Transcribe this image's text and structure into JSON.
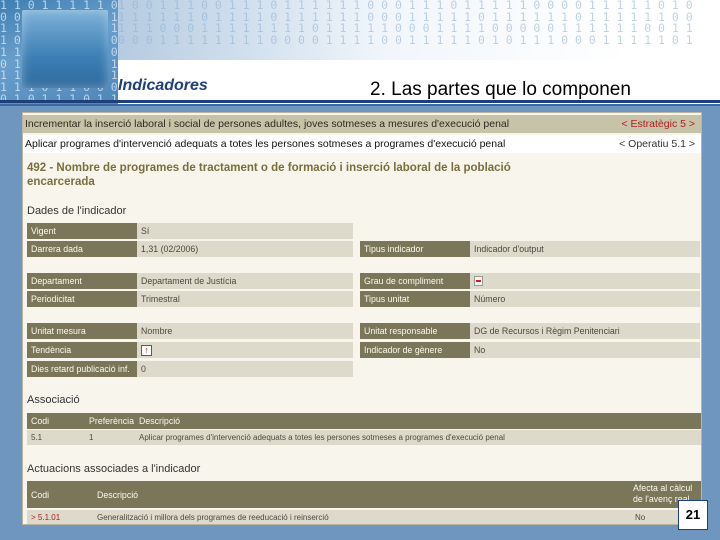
{
  "slide": {
    "section": "Indicadores",
    "title": "2. Las partes que lo componen",
    "page_number": "21"
  },
  "screenshot": {
    "breadcrumb_objective": {
      "text": "Incrementar la inserció laboral i social de persones adultes, joves sotmeses a mesures d'execució penal",
      "nav": "< Estratègic 5 >"
    },
    "breadcrumb_operational": {
      "text": "Aplicar programes d'intervenció adequats a totes les persones sotmeses a programes d'execució penal",
      "nav": "< Operatiu 5.1 >"
    },
    "indicator_title": "492 - Nombre de programes de tractament o de formació i inserció laboral de la població encarcerada",
    "dades_heading": "Dades de l'indicador",
    "fields": {
      "vigent": {
        "label": "Vigent",
        "value": "Sí"
      },
      "darrera_dada": {
        "label": "Darrera dada",
        "value": "1,31 (02/2006)"
      },
      "tipus_indicador": {
        "label": "Tipus indicador",
        "value": "Indicador d'output"
      },
      "departament": {
        "label": "Departament",
        "value": "Departament de Justícia"
      },
      "grau_compliment": {
        "label": "Grau de compliment",
        "icon": "book-icon"
      },
      "periodicitat": {
        "label": "Periodicitat",
        "value": "Trimestral"
      },
      "tipus_unitat": {
        "label": "Tipus unitat",
        "value": "Número"
      },
      "unitat_mesura": {
        "label": "Unitat mesura",
        "value": "Nombre"
      },
      "unitat_responsable": {
        "label": "Unitat responsable",
        "value": "DG de Recursos i Règim Penitenciari"
      },
      "tendencia": {
        "label": "Tendència",
        "icon": "arrow-up-icon"
      },
      "indicador_genere": {
        "label": "Indicador de gènere",
        "value": "No"
      },
      "dies_retard": {
        "label": "Dies retard publicació inf.",
        "value": "0"
      }
    },
    "associacio": {
      "heading": "Associació",
      "columns": [
        "Codi",
        "Preferència",
        "Descripció"
      ],
      "rows": [
        {
          "codi": "5.1",
          "preferencia": "1",
          "descripcio": "Aplicar programes d'intervenció adequats a totes les persones sotmeses a programes d'execució penal"
        }
      ]
    },
    "actuacions": {
      "heading": "Actuacions associades a l'indicador",
      "columns": [
        "Codi",
        "Descripció",
        "Afecta al càlcul de l'avenç real"
      ],
      "rows": [
        {
          "codi": "> 5.1.01",
          "descripcio": "Generalització i millora dels programes de reeducació i reinserció",
          "afecta": "No"
        }
      ]
    }
  },
  "colors": {
    "header_title": "#1f3f78",
    "label_bg": "#7b7659",
    "value_bg": "#dedacb",
    "link_red": "#b21c1c"
  }
}
